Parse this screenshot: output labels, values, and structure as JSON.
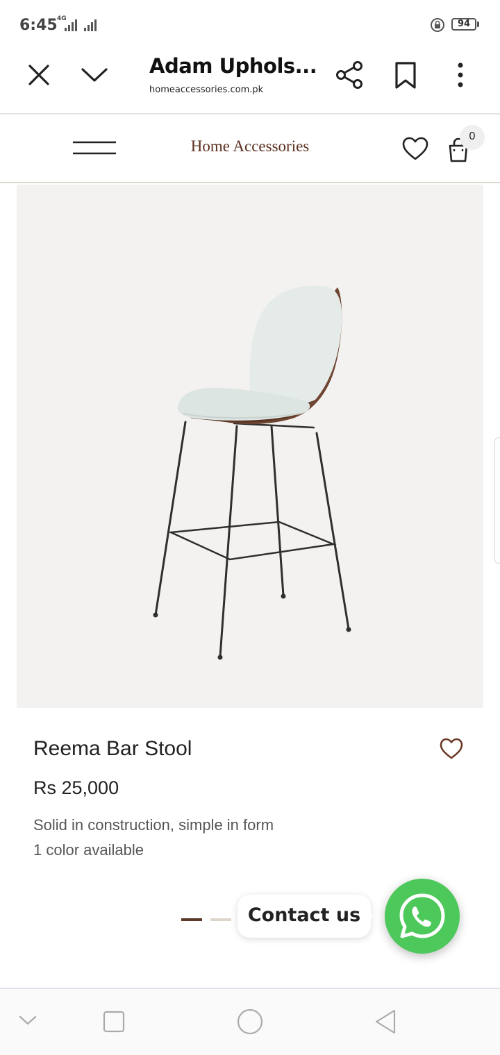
{
  "status_bar": {
    "time": "6:45",
    "network": "4G",
    "battery": "94"
  },
  "browser": {
    "title": "Adam Uphols...",
    "url": "homeaccessories.com.pk",
    "icons": [
      "close-icon",
      "chevron-down-icon",
      "share-icon",
      "bookmark-icon",
      "more-vert-icon"
    ]
  },
  "site_header": {
    "brand": "Home Accessories",
    "cart_count": "0",
    "icons": [
      "menu-icon",
      "heart-icon",
      "shopping-bag-icon"
    ]
  },
  "product": {
    "name": "Reema Bar Stool",
    "price": "Rs 25,000",
    "description": "Solid in construction, simple in form",
    "colors": "1 color available"
  },
  "carousel": {
    "slides": 2,
    "active": 1
  },
  "contact": {
    "label": "Contact us",
    "color": "#4dc85b"
  },
  "colors": {
    "brand": "#5b2f1f",
    "image_bg": "#f3f2f0"
  },
  "nav_bar": {
    "icons": [
      "nav-collapse-icon",
      "recents-icon",
      "home-icon",
      "back-icon"
    ]
  }
}
